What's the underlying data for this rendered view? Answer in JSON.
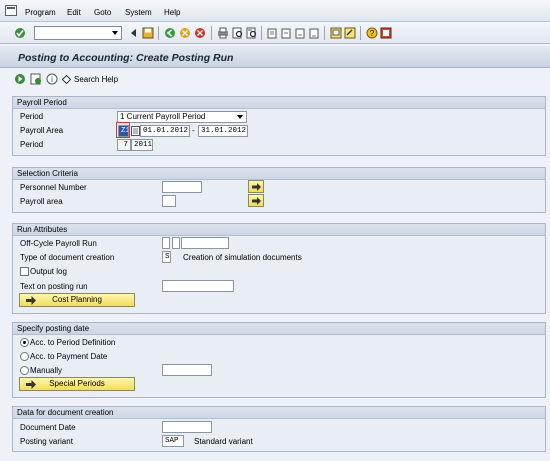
{
  "menu": {
    "items": [
      "Program",
      "Edit",
      "Goto",
      "System",
      "Help"
    ]
  },
  "toolbar": {
    "command_value": "",
    "icons": [
      "enter-icon",
      "save-icon",
      "back-icon",
      "exit-icon",
      "cancel-icon",
      "print-icon",
      "find-icon",
      "find-next-icon",
      "first-page-icon",
      "previous-page-icon",
      "next-page-icon",
      "last-page-icon",
      "new-session-icon",
      "shortcut-icon",
      "help-icon",
      "customize-layout-icon"
    ]
  },
  "title": "Posting to Accounting: Create Posting Run",
  "app_toolbar": {
    "search_help_label": "Search Help",
    "icons": [
      "execute-icon",
      "variant-icon",
      "info-icon",
      "search-help-icon"
    ]
  },
  "payroll_period": {
    "header": "Payroll Period",
    "period_label": "Period",
    "period_selected": "1 Current Payroll Period",
    "payroll_area_label": "Payroll Area",
    "payroll_area_value": "Z1",
    "date_from": "01.01.2012",
    "date_dash": "-",
    "date_to": "31.01.2012",
    "period2_label": "Period",
    "period_number": "7",
    "period_year": "2011"
  },
  "selection": {
    "header": "Selection Criteria",
    "personnel_number_label": "Personnel Number",
    "personnel_number_value": "",
    "payroll_area_label": "Payroll area",
    "payroll_area_value": ""
  },
  "run_attributes": {
    "header": "Run Attributes",
    "off_cycle_label": "Off-Cycle Payroll Run",
    "doc_type_label": "Type of document creation",
    "doc_type_value": "S",
    "doc_type_text": "Creation of simulation documents",
    "output_log_label": "Output log",
    "output_log_checked": false,
    "text_label": "Text on posting run",
    "text_value": "",
    "cost_planning_label": "Cost Planning"
  },
  "posting_date": {
    "header": "Specify posting date",
    "options": [
      "Acc. to Period Definition",
      "Acc. to Payment Date",
      "Manually"
    ],
    "selected_index": 0,
    "manual_date": "",
    "special_periods_label": "Special Periods"
  },
  "doc_creation": {
    "header": "Data for document creation",
    "document_date_label": "Document Date",
    "document_date_value": "",
    "posting_variant_label": "Posting variant",
    "posting_variant_value": "SAP",
    "posting_variant_text": "Standard variant"
  }
}
